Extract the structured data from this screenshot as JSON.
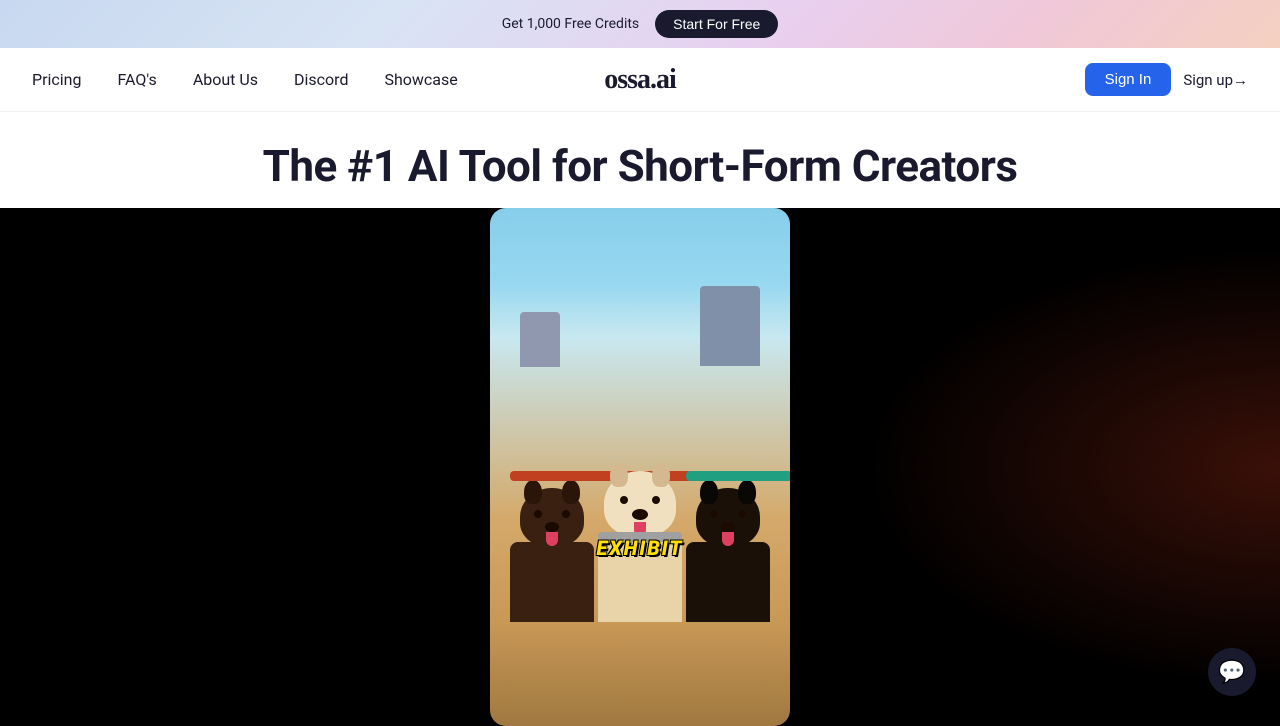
{
  "banner": {
    "text": "Get 1,000 Free Credits",
    "button_label": "Start For Free"
  },
  "navbar": {
    "links": [
      {
        "label": "Pricing",
        "id": "pricing"
      },
      {
        "label": "FAQ's",
        "id": "faqs"
      },
      {
        "label": "About Us",
        "id": "about"
      },
      {
        "label": "Discord",
        "id": "discord"
      },
      {
        "label": "Showcase",
        "id": "showcase"
      }
    ],
    "logo": "ossa.ai",
    "sign_in": "Sign In",
    "sign_up": "Sign up→"
  },
  "hero": {
    "title": "The #1 AI Tool for Short-Form Creators"
  },
  "video": {
    "exhibit_text": "EXHIBIT"
  },
  "chat": {
    "icon": "💬"
  }
}
